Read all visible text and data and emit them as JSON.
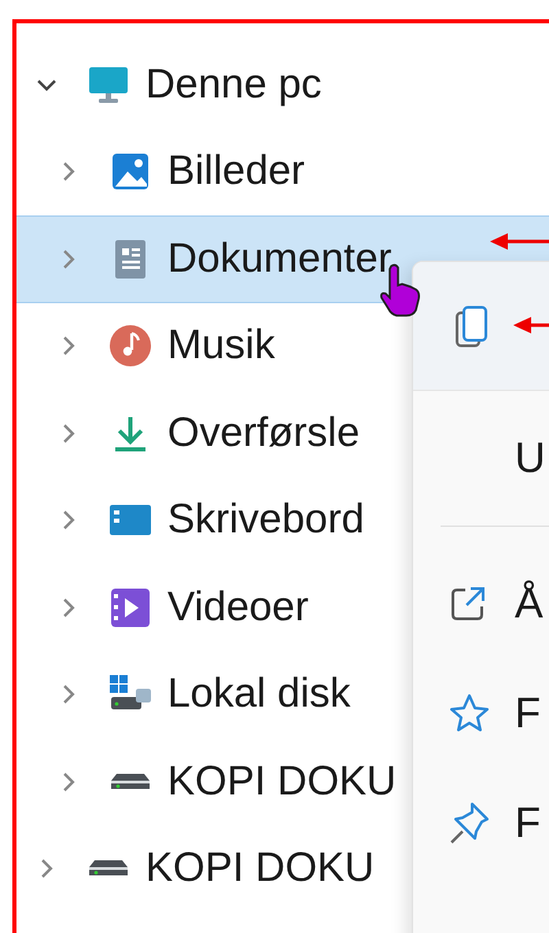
{
  "tree": [
    {
      "label": "Denne pc",
      "kind": "pc",
      "expanded": true,
      "selected": false,
      "children": [
        {
          "label": "Billeder",
          "kind": "pictures",
          "expanded": false,
          "selected": false
        },
        {
          "label": "Dokumenter",
          "kind": "documents",
          "expanded": false,
          "selected": true
        },
        {
          "label": "Musik",
          "kind": "music",
          "expanded": false,
          "selected": false
        },
        {
          "label": "Overførsle",
          "kind": "downloads",
          "expanded": false,
          "selected": false
        },
        {
          "label": "Skrivebord",
          "kind": "desktop",
          "expanded": false,
          "selected": false
        },
        {
          "label": "Videoer",
          "kind": "videos",
          "expanded": false,
          "selected": false
        },
        {
          "label": "Lokal disk",
          "kind": "system-drive",
          "expanded": false,
          "selected": false
        },
        {
          "label": "KOPI DOKU",
          "kind": "drive",
          "expanded": false,
          "selected": false
        }
      ]
    },
    {
      "label": "KOPI DOKU",
      "kind": "drive",
      "expanded": false,
      "selected": false
    }
  ],
  "context_menu": {
    "items": [
      {
        "kind": "icon-bar",
        "selected": true
      },
      {
        "kind": "text",
        "label": "U",
        "selected": false
      },
      {
        "kind": "separator"
      },
      {
        "kind": "open",
        "label": "Å",
        "selected": false
      },
      {
        "kind": "favorite",
        "label": "F",
        "selected": false
      },
      {
        "kind": "pin",
        "label": "F",
        "selected": false
      }
    ]
  }
}
